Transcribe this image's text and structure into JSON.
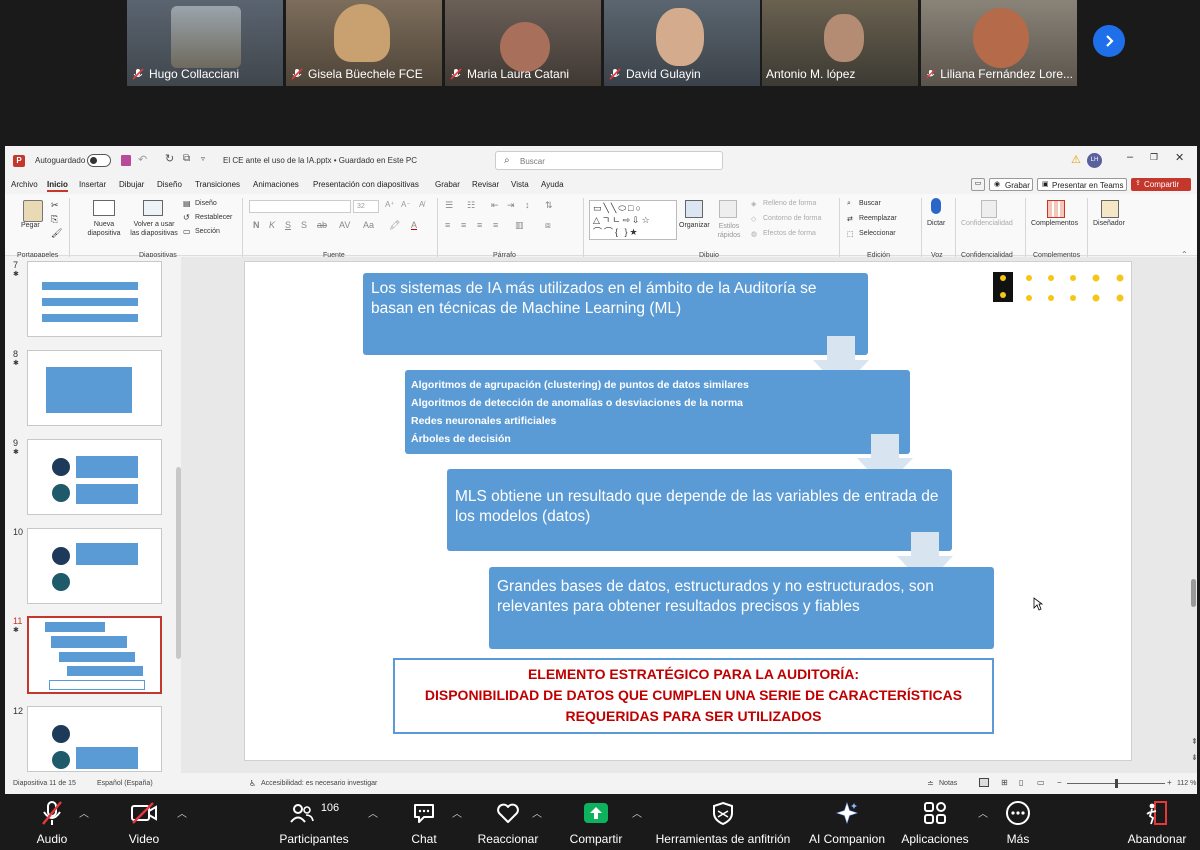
{
  "participants": [
    {
      "name": "Hugo Collacciani",
      "muted": true
    },
    {
      "name": "Gisela Büechele FCE",
      "muted": true
    },
    {
      "name": "Maria Laura Catani",
      "muted": true
    },
    {
      "name": "David Gulayin",
      "muted": true
    },
    {
      "name": "Antonio M. lópez",
      "muted": false
    },
    {
      "name": "Liliana Fernández Lore...",
      "muted": true
    }
  ],
  "powerpoint": {
    "autosave_label": "Autoguardado",
    "doc_title": "El CE ante el uso de la IA.pptx • Guardado en Este PC",
    "search_placeholder": "Buscar",
    "user_initials": "LH",
    "menu": [
      "Archivo",
      "Inicio",
      "Insertar",
      "Dibujar",
      "Diseño",
      "Transiciones",
      "Animaciones",
      "Presentación con diapositivas",
      "Grabar",
      "Revisar",
      "Vista",
      "Ayuda"
    ],
    "active_menu": "Inicio",
    "grabar_btn": "Grabar",
    "teams_btn": "Presentar en Teams",
    "share_btn": "Compartir",
    "ribbon": {
      "pegar": "Pegar",
      "portapapeles": "Portapapeles",
      "nueva_diapositiva": "Nueva diapositiva",
      "volver_usar": "Volver a usar las diapositivas",
      "diseno": "Diseño",
      "restablecer": "Restablecer",
      "seccion": "Sección",
      "diapositivas": "Diapositivas",
      "font_size": "32",
      "fuente": "Fuente",
      "parrafo": "Párrafo",
      "organizar": "Organizar",
      "estilos_rapidos": "Estilos rápidos",
      "relleno": "Relleno de forma",
      "contorno": "Contorno de forma",
      "efectos": "Efectos de forma",
      "dibujo": "Dibujo",
      "buscar": "Buscar",
      "reemplazar": "Reemplazar",
      "seleccionar": "Seleccionar",
      "edicion": "Edición",
      "dictar": "Dictar",
      "voz": "Voz",
      "confidencialidad": "Confidencialidad",
      "complementos": "Complementos",
      "disenador": "Diseñador"
    },
    "thumbnails": [
      {
        "num": "7",
        "star": "✱"
      },
      {
        "num": "8",
        "star": "✱"
      },
      {
        "num": "9",
        "star": "✱"
      },
      {
        "num": "10",
        "star": ""
      },
      {
        "num": "11",
        "star": "✱"
      },
      {
        "num": "12",
        "star": ""
      }
    ],
    "slide": {
      "box1": "Los sistemas de IA más utilizados en el ámbito de la Auditoría se basan en técnicas de Machine Learning (ML)",
      "list_items": [
        "Algoritmos de agrupación (clustering) de puntos de datos similares",
        "Algoritmos de detección de anomalías o desviaciones de la norma",
        "Redes neuronales artificiales",
        "Árboles de decisión"
      ],
      "box3": "MLS obtiene un resultado que depende de las variables de entrada de los modelos (datos)",
      "box4": "Grandes bases de datos, estructurados y no estructurados, son relevantes para obtener resultados precisos y fiables",
      "callout_line1": "ELEMENTO ESTRATÉGICO PARA LA AUDITORÍA:",
      "callout_line2": "DISPONIBILIDAD DE DATOS QUE CUMPLEN UNA SERIE DE CARACTERÍSTICAS",
      "callout_line3": "REQUERIDAS PARA SER UTILIZADOS"
    },
    "status": {
      "slide_counter": "Diapositiva 11 de 15",
      "language": "Español (España)",
      "accessibility": "Accesibilidad: es necesario investigar",
      "notes": "Notas",
      "zoom": "112 %"
    }
  },
  "toolbar": {
    "audio": "Audio",
    "video": "Video",
    "participants": "Participantes",
    "participants_count": "106",
    "chat": "Chat",
    "react": "Reaccionar",
    "share": "Compartir",
    "host_tools": "Herramientas de anfitrión",
    "ai_companion": "AI Companion",
    "apps": "Aplicaciones",
    "more": "Más",
    "leave": "Abandonar"
  },
  "colors": {
    "box_blue": "#5b9bd5",
    "callout_red": "#c00000",
    "active_speaker": "#2ecc71",
    "share_green": "#0eb25e",
    "ppt_accent": "#c4372c"
  }
}
